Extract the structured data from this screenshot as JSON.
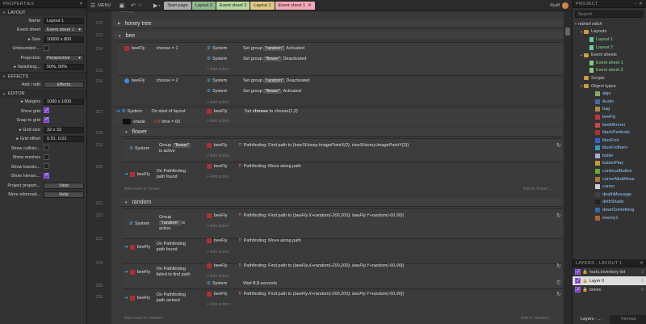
{
  "left": {
    "title": "PROPERTIES",
    "layout_section": "LAYOUT",
    "name_label": "Name",
    "name_value": "Layout 1",
    "eventsheet_label": "Event sheet",
    "eventsheet_value": "Event sheet 1",
    "size_label": "Size",
    "size_value": "10000 x 800",
    "unbounded_label": "Unbounded ...",
    "projection_label": "Projection",
    "projection_value": "Perspective",
    "vanishing_label": "Vanishing...",
    "vanishing_value": "50%, 50%",
    "effects_section": "EFFECTS",
    "addedit_label": "Add / edit",
    "effects_button": "Effects",
    "editor_section": "EDITOR",
    "margins_label": "Margins",
    "margins_value": "1000 x 1000",
    "showgrid_label": "Show grid",
    "snapgrid_label": "Snap to grid",
    "gridsize_label": "Grid size",
    "gridsize_value": "32 x 32",
    "gridoffset_label": "Grid offset",
    "gridoffset_value": "0.01, 0.01",
    "showcollision_label": "Show collisio...",
    "showmeshes_label": "Show meshes",
    "showtransl_label": "Show translu...",
    "showhier_label": "Show hierarc...",
    "projprops_label": "Project propert...",
    "view_button": "View",
    "moreinfo_label": "More informati...",
    "help_button": "Help"
  },
  "topbar": {
    "menu": "MENU",
    "tabs": [
      "Start page",
      "Layout 2",
      "Event sheet 2",
      "Layout 1",
      "Event sheet 1"
    ],
    "user": "Ryaff"
  },
  "main": {
    "top_partial": "honey",
    "rows": {
      "r212": "212",
      "r213": "213",
      "r214": "214",
      "r215": "215",
      "r216": "216",
      "r217": "217",
      "r218": "218",
      "r219": "219",
      "r220": "220",
      "r221": "221",
      "r222": "222",
      "r223": "223",
      "r224": "224",
      "r225": "225",
      "r226": "226"
    },
    "group_honey": "honey tree",
    "group_bee": "bee",
    "group_flower": "flower",
    "group_random": "random",
    "obj_beefly": "beeFly",
    "obj_system": "System",
    "obj_shade": "shade",
    "e1_cond": "choose = 1",
    "e1_a1": "Set group",
    "e1_a1_str": "\"random\"",
    "e1_a1_end": "Activated",
    "e1_a2": "Set group",
    "e1_a2_str": "\"flower\"",
    "e1_a2_end": "Deactivated",
    "e2_cond": "choose = 2",
    "e2_a1": "Set group",
    "e2_a1_str": "\"random\"",
    "e2_a1_end": "Deactivated",
    "e2_a2": "Set group",
    "e2_a2_str": "\"flower\"",
    "e2_a2_end": "Activated",
    "add_action": "Add action",
    "e3_cond": "On start of layout",
    "e3_cond2_pre": "Off",
    "e3_cond2": "time = 60",
    "e3_a1_pre": "Set",
    "e3_a1_b": "choose",
    "e3_a1_end": "to choose(1,2)",
    "f1_cond": "Group",
    "f1_cond_str": "\"flower\"",
    "f1_cond_end": "is active",
    "f1_act": "Pathfinding: Find path to (",
    "f1_act_it": "treeSHoney.ImagePointX(2), treeSHoney.ImagePointY(2)",
    "f1_act_end": ")",
    "f2_cond": "On Pathfinding path found",
    "f2_act": "Pathfinding: Move along path",
    "add_event_flower": "Add event to 'flower'",
    "add_to_flower": "Add to 'flower'...",
    "r1_cond": "Group",
    "r1_cond_str": "\"random\"",
    "r1_cond_end": "is active",
    "r1_act": "Pathfinding: Find path to (",
    "r1_act_it": "beeFly.X+random(-200,200), beeFly.Y+random(-60,90)",
    "r1_act_end": ")",
    "r2_cond": "On Pathfinding path found",
    "r2_act": "Pathfinding: Move along path",
    "r3_cond": "On Pathfinding failed to find path",
    "r3_act": "Pathfinding: Find path to (",
    "r3_act_it": "beeFly.X+random(-200,200), beeFly.Y+random(-60,90)",
    "r3_act_end": ")",
    "r4_cond": "On Pathfinding path arrived",
    "r4_a1": "Wait",
    "r4_a1_b": "0.3",
    "r4_a1_end": "seconds",
    "r4_a2": "Pathfinding: Find path to (",
    "r4_a2_it": "beeFly.X+random(-200,200), beeFly.Y+random(-60,90)",
    "r4_a2_end": ")",
    "add_event_random": "Add event to 'random'",
    "add_to_random": "Add to 'random'..."
  },
  "right": {
    "title": "PROJECT",
    "search_placeholder": "Search",
    "tree": {
      "root": "retired witch",
      "layouts": "Layouts",
      "layout1": "Layout 1",
      "layout2": "Layout 2",
      "eventsheets": "Event sheets",
      "es1": "Event sheet 1",
      "es2": "Event sheet 2",
      "scripts": "Scripts",
      "objtypes": "Object types",
      "objects": [
        "algo",
        "Audio",
        "bag",
        "beeFly",
        "beeMirrorer",
        "blackParticals",
        "blueFrut",
        "blueFrothern",
        "buble",
        "buttonPlay",
        "continueButton",
        "cornerMudMove",
        "cursor",
        "deathMessage",
        "dethShade",
        "downSomething",
        "enemy1"
      ]
    },
    "layers_title": "LAYERS - LAYOUT 1",
    "layers": [
      {
        "name": "harts,inventory list",
        "n": "2"
      },
      {
        "name": "Layer 0",
        "n": "1"
      },
      {
        "name": "below",
        "n": "0"
      }
    ],
    "tab1": "Layers - ...",
    "tab2": "Tilemap"
  }
}
